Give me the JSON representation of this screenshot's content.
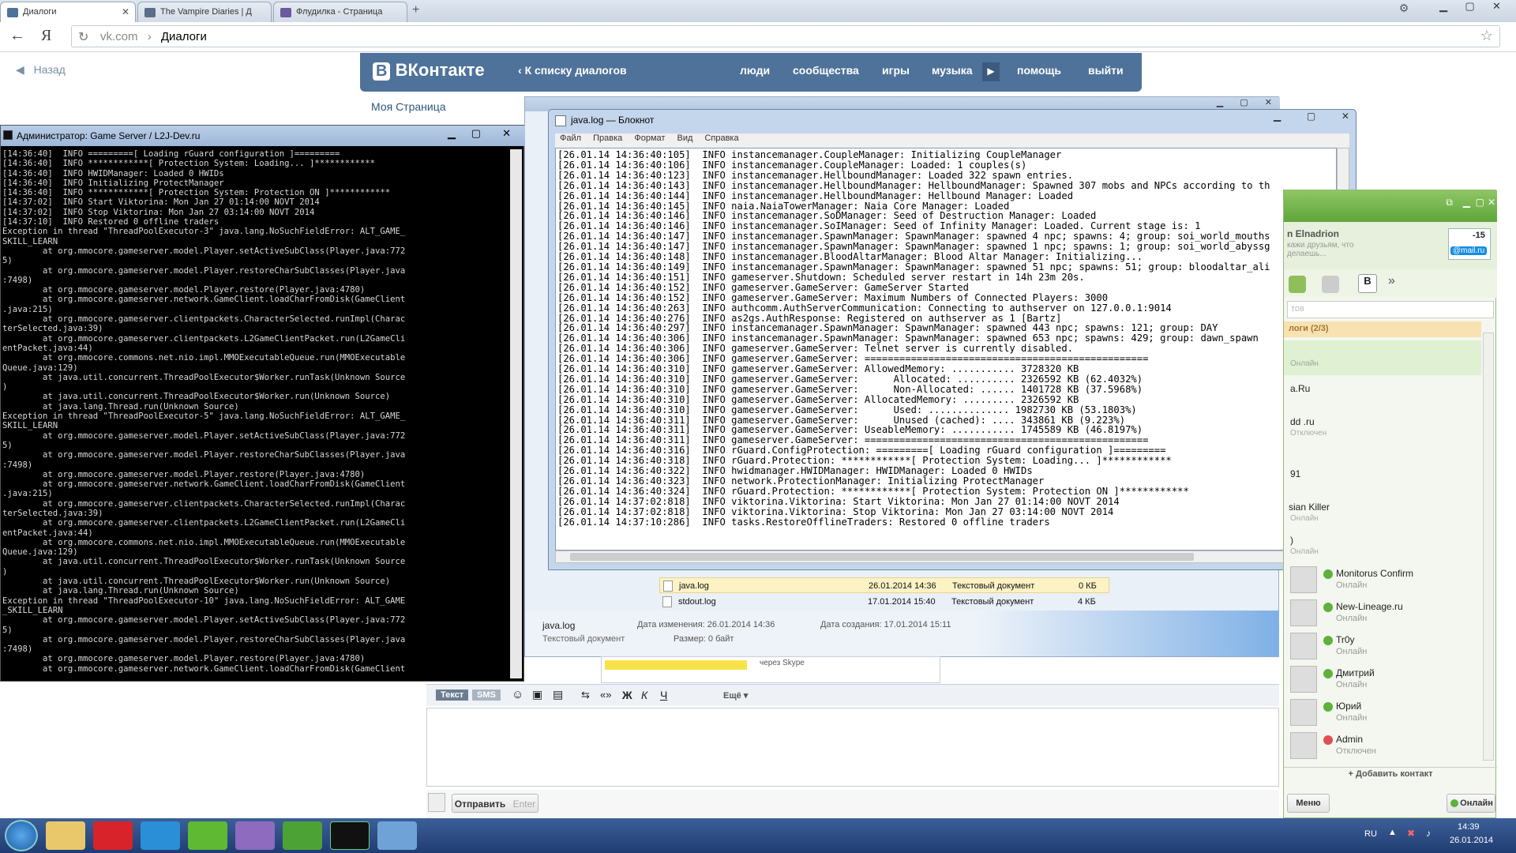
{
  "browser": {
    "tabs": [
      {
        "label": "Диалоги",
        "color": "#4e729a"
      },
      {
        "label": "The Vampire Diaries | Д",
        "color": "#5a6e8a"
      },
      {
        "label": "Флудилка - Страница",
        "color": "#6a5aa0"
      }
    ],
    "new_tab": "+",
    "url_host": "vk.com",
    "url_sep": "›",
    "url_path": "Диалоги",
    "yandex_glyph": "Я"
  },
  "vk": {
    "back_label": "Назад",
    "logo": "ВКонтакте",
    "to_dialogs": "К списку диалогов",
    "nav": [
      "люди",
      "сообщества",
      "игры",
      "музыка",
      "помощь",
      "выйти"
    ],
    "my_page": "Моя Страница"
  },
  "console": {
    "title": "Администратор:  Game Server / L2J-Dev.ru",
    "lines": [
      "[14:36:40]  INFO =========[ Loading rGuard configuration ]=========",
      "[14:36:40]  INFO ************[ Protection System: Loading... ]************",
      "[14:36:40]  INFO HWIDManager: Loaded 0 HWIDs",
      "[14:36:40]  INFO Initializing ProtectManager",
      "[14:36:40]  INFO ************[ Protection System: Protection ON ]************",
      "[14:37:02]  INFO Start Viktorina: Mon Jan 27 01:14:00 NOVT 2014",
      "[14:37:02]  INFO Stop Viktorina: Mon Jan 27 03:14:00 NOVT 2014",
      "[14:37:10]  INFO Restored 0 offline traders",
      "Exception in thread \"ThreadPoolExecutor-3\" java.lang.NoSuchFieldError: ALT_GAME_",
      "SKILL_LEARN",
      "        at org.mmocore.gameserver.model.Player.setActiveSubClass(Player.java:772",
      "5)",
      "        at org.mmocore.gameserver.model.Player.restoreCharSubClasses(Player.java",
      ":7498)",
      "        at org.mmocore.gameserver.model.Player.restore(Player.java:4780)",
      "        at org.mmocore.gameserver.network.GameClient.loadCharFromDisk(GameClient",
      ".java:215)",
      "        at org.mmocore.gameserver.clientpackets.CharacterSelected.runImpl(Charac",
      "terSelected.java:39)",
      "        at org.mmocore.gameserver.clientpackets.L2GameClientPacket.run(L2GameCli",
      "entPacket.java:44)",
      "        at org.mmocore.commons.net.nio.impl.MMOExecutableQueue.run(MMOExecutable",
      "Queue.java:129)",
      "        at java.util.concurrent.ThreadPoolExecutor$Worker.runTask(Unknown Source",
      ")",
      "        at java.util.concurrent.ThreadPoolExecutor$Worker.run(Unknown Source)",
      "        at java.lang.Thread.run(Unknown Source)",
      "Exception in thread \"ThreadPoolExecutor-5\" java.lang.NoSuchFieldError: ALT_GAME_",
      "SKILL_LEARN",
      "        at org.mmocore.gameserver.model.Player.setActiveSubClass(Player.java:772",
      "5)",
      "        at org.mmocore.gameserver.model.Player.restoreCharSubClasses(Player.java",
      ":7498)",
      "        at org.mmocore.gameserver.model.Player.restore(Player.java:4780)",
      "        at org.mmocore.gameserver.network.GameClient.loadCharFromDisk(GameClient",
      ".java:215)",
      "        at org.mmocore.gameserver.clientpackets.CharacterSelected.runImpl(Charac",
      "terSelected.java:39)",
      "        at org.mmocore.gameserver.clientpackets.L2GameClientPacket.run(L2GameCli",
      "entPacket.java:44)",
      "        at org.mmocore.commons.net.nio.impl.MMOExecutableQueue.run(MMOExecutable",
      "Queue.java:129)",
      "        at java.util.concurrent.ThreadPoolExecutor$Worker.runTask(Unknown Source",
      ")",
      "        at java.util.concurrent.ThreadPoolExecutor$Worker.run(Unknown Source)",
      "        at java.lang.Thread.run(Unknown Source)",
      "Exception in thread \"ThreadPoolExecutor-10\" java.lang.NoSuchFieldError: ALT_GAME",
      "_SKILL_LEARN",
      "        at org.mmocore.gameserver.model.Player.setActiveSubClass(Player.java:772",
      "5)",
      "        at org.mmocore.gameserver.model.Player.restoreCharSubClasses(Player.java",
      ":7498)",
      "        at org.mmocore.gameserver.model.Player.restore(Player.java:4780)",
      "        at org.mmocore.gameserver.network.GameClient.loadCharFromDisk(GameClient"
    ]
  },
  "notepad": {
    "title": "java.log — Блокнот",
    "menu": [
      "Файл",
      "Правка",
      "Формат",
      "Вид",
      "Справка"
    ],
    "lines": [
      "[26.01.14 14:36:40:105]  INFO instancemanager.CoupleManager: Initializing CoupleManager",
      "[26.01.14 14:36:40:106]  INFO instancemanager.CoupleManager: Loaded: 1 couples(s)",
      "[26.01.14 14:36:40:123]  INFO instancemanager.HellboundManager: Loaded 322 spawn entries.",
      "[26.01.14 14:36:40:143]  INFO instancemanager.HellboundManager: HellboundManager: Spawned 307 mobs and NPCs according to th",
      "[26.01.14 14:36:40:144]  INFO instancemanager.HellboundManager: Hellbound Manager: Loaded",
      "[26.01.14 14:36:40:145]  INFO naia.NaiaTowerManager: Naia Core Manager: Loaded",
      "[26.01.14 14:36:40:146]  INFO instancemanager.SoDManager: Seed of Destruction Manager: Loaded",
      "[26.01.14 14:36:40:146]  INFO instancemanager.SoIManager: Seed of Infinity Manager: Loaded. Current stage is: 1",
      "[26.01.14 14:36:40:147]  INFO instancemanager.SpawnManager: SpawnManager: spawned 4 npc; spawns: 4; group: soi_world_mouths",
      "[26.01.14 14:36:40:147]  INFO instancemanager.SpawnManager: SpawnManager: spawned 1 npc; spawns: 1; group: soi_world_abyssg",
      "[26.01.14 14:36:40:148]  INFO instancemanager.BloodAltarManager: Blood Altar Manager: Initializing...",
      "[26.01.14 14:36:40:149]  INFO instancemanager.SpawnManager: SpawnManager: spawned 51 npc; spawns: 51; group: bloodaltar_ali",
      "[26.01.14 14:36:40:151]  INFO gameserver.Shutdown: Scheduled server restart in 14h 23m 20s.",
      "[26.01.14 14:36:40:152]  INFO gameserver.GameServer: GameServer Started",
      "[26.01.14 14:36:40:152]  INFO gameserver.GameServer: Maximum Numbers of Connected Players: 3000",
      "[26.01.14 14:36:40:263]  INFO authcomm.AuthServerCommunication: Connecting to authserver on 127.0.0.1:9014",
      "[26.01.14 14:36:40:276]  INFO as2gs.AuthResponse: Registered on authserver as 1 [Bartz]",
      "[26.01.14 14:36:40:297]  INFO instancemanager.SpawnManager: SpawnManager: spawned 443 npc; spawns: 121; group: DAY",
      "[26.01.14 14:36:40:306]  INFO instancemanager.SpawnManager: SpawnManager: spawned 653 npc; spawns: 429; group: dawn_spawn",
      "[26.01.14 14:36:40:306]  INFO gameserver.GameServer: Telnet server is currently disabled.",
      "[26.01.14 14:36:40:306]  INFO gameserver.GameServer: =================================================",
      "[26.01.14 14:36:40:310]  INFO gameserver.GameServer: AllowedMemory: ........... 3728320 KB",
      "[26.01.14 14:36:40:310]  INFO gameserver.GameServer:      Allocated: .......... 2326592 KB (62.4032%)",
      "[26.01.14 14:36:40:310]  INFO gameserver.GameServer:      Non-Allocated: ...... 1401728 KB (37.5968%)",
      "[26.01.14 14:36:40:310]  INFO gameserver.GameServer: AllocatedMemory: ......... 2326592 KB",
      "[26.01.14 14:36:40:310]  INFO gameserver.GameServer:      Used: .............. 1982730 KB (53.1803%)",
      "[26.01.14 14:36:40:311]  INFO gameserver.GameServer:      Unused (cached): .... 343861 KB (9.223%)",
      "[26.01.14 14:36:40:311]  INFO gameserver.GameServer: UseableMemory: ........... 1745589 KB (46.8197%)",
      "[26.01.14 14:36:40:311]  INFO gameserver.GameServer: =================================================",
      "[26.01.14 14:36:40:316]  INFO rGuard.ConfigProtection: =========[ Loading rGuard configuration ]=========",
      "[26.01.14 14:36:40:318]  INFO rGuard.Protection: ************[ Protection System: Loading... ]************",
      "[26.01.14 14:36:40:322]  INFO hwidmanager.HWIDManager: HWIDManager: Loaded 0 HWIDs",
      "[26.01.14 14:36:40:323]  INFO network.ProtectionManager: Initializing ProtectManager",
      "[26.01.14 14:36:40:324]  INFO rGuard.Protection: ************[ Protection System: Protection ON ]************",
      "[26.01.14 14:37:02:818]  INFO viktorina.Viktorina: Start Viktorina: Mon Jan 27 01:14:00 NOVT 2014",
      "[26.01.14 14:37:02:818]  INFO viktorina.Viktorina: Stop Viktorina: Mon Jan 27 03:14:00 NOVT 2014",
      "[26.01.14 14:37:10:286]  INFO tasks.RestoreOfflineTraders: Restored 0 offline traders"
    ]
  },
  "explorer": {
    "files": [
      {
        "name": "java.log",
        "date": "26.01.2014 14:36",
        "type": "Текстовый документ",
        "size": "0 КБ",
        "selected": true
      },
      {
        "name": "stdout.log",
        "date": "17.01.2014 15:40",
        "type": "Текстовый документ",
        "size": "4 КБ",
        "selected": false
      }
    ],
    "details": {
      "name": "java.log",
      "modified_label": "Дата изменения: 26.01.2014 14:36",
      "created_label": "Дата создания: 17.01.2014 15:11",
      "type": "Текстовый документ",
      "size_label": "Размер: 0 байт"
    },
    "skype_label": "через Skype"
  },
  "chat": {
    "tab_text": "Текст",
    "tab_sms": "SMS",
    "more": "Ещё",
    "send": "Отправить",
    "send_hint": "Enter"
  },
  "mailagent": {
    "user_name": "n Elnadrion",
    "status_placeholder": "кажи друзьям, что\nделаешь...",
    "mail_label": "@mail.ru",
    "unread": "-15",
    "search_placeholder": "тов",
    "group_label": "логи",
    "group_count": "(2/3)",
    "partial_items": [
      "a.Ru",
      "dd .ru",
      "91",
      "sian Killer",
      ")"
    ],
    "partial_status": [
      "Онлайн",
      "Онлайн",
      "Отключен",
      "Онлайн",
      "Онлайн"
    ],
    "contacts": [
      {
        "name": "Monitorus Confirm",
        "status": "Онлайн",
        "dot": "#5cb23a"
      },
      {
        "name": "New-Lineage.ru",
        "status": "Онлайн",
        "dot": "#5cb23a"
      },
      {
        "name": "Tr0y",
        "status": "Онлайн",
        "dot": "#5cb23a"
      },
      {
        "name": "Дмитрий",
        "status": "Онлайн",
        "dot": "#5cb23a"
      },
      {
        "name": "Юрий",
        "status": "Онлайн",
        "dot": "#5cb23a"
      },
      {
        "name": "Admin",
        "status": "Отключен",
        "dot": "#e05050"
      }
    ],
    "add_contact": "+ Добавить контакт",
    "menu_button": "Меню",
    "status_button": "Онлайн"
  },
  "taskbar": {
    "lang": "RU",
    "time": "14:39",
    "date": "26.01.2014"
  }
}
